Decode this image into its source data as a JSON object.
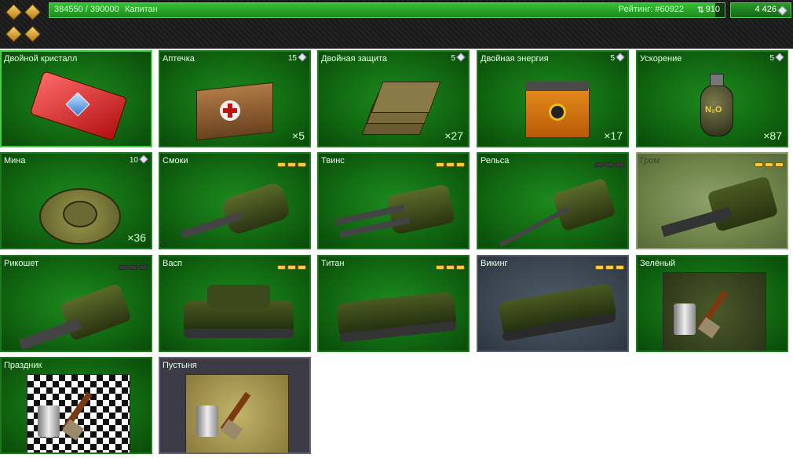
{
  "header": {
    "xp_text": "384550 / 390000",
    "rank": "Капитан",
    "xp_progress": 0.986,
    "rating_label": "Рейтинг: #60922",
    "rating_change": "910",
    "crystals": "4 426"
  },
  "cards": [
    {
      "name": "Двойной кристалл",
      "price": "",
      "qty": "",
      "level": null
    },
    {
      "name": "Аптечка",
      "price": "15",
      "qty": "×5",
      "level": null
    },
    {
      "name": "Двойная защита",
      "price": "5",
      "qty": "×27",
      "level": null
    },
    {
      "name": "Двойная энергия",
      "price": "5",
      "qty": "×17",
      "level": null
    },
    {
      "name": "Ускорение",
      "price": "5",
      "qty": "×87",
      "level": null
    },
    {
      "name": "Мина",
      "price": "10",
      "qty": "×36",
      "level": null
    },
    {
      "name": "Смоки",
      "price": "",
      "qty": "",
      "level": 3
    },
    {
      "name": "Твинс",
      "price": "",
      "qty": "",
      "level": 3
    },
    {
      "name": "Рельса",
      "price": "",
      "qty": "",
      "level": 0
    },
    {
      "name": "Гром",
      "price": "",
      "qty": "",
      "level": 3
    },
    {
      "name": "Рикошет",
      "price": "",
      "qty": "",
      "level": 0
    },
    {
      "name": "Васп",
      "price": "",
      "qty": "",
      "level": 3
    },
    {
      "name": "Титан",
      "price": "",
      "qty": "",
      "level": 3
    },
    {
      "name": "Викинг",
      "price": "",
      "qty": "",
      "level": 3
    },
    {
      "name": "Зелёный",
      "price": "",
      "qty": "",
      "level": null
    },
    {
      "name": "Праздник",
      "price": "",
      "qty": "",
      "level": null
    },
    {
      "name": "Пустыня",
      "price": "",
      "qty": "",
      "level": null
    }
  ],
  "colors": {
    "accent": "#3fd23f",
    "card_bg": "#126a12",
    "level_on": "#ffcc33"
  }
}
